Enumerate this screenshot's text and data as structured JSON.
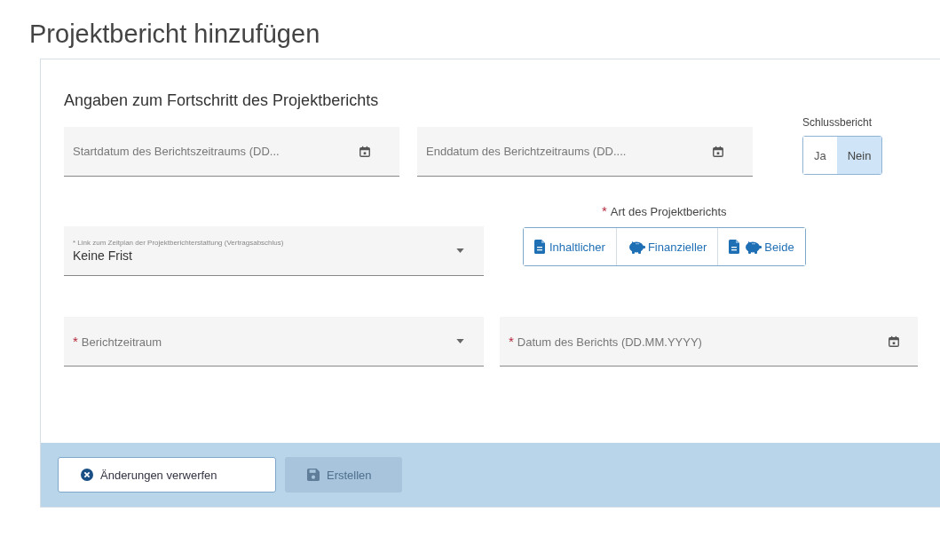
{
  "page_title": "Projektbericht hinzufügen",
  "section_title": "Angaben zum Fortschritt des Projektberichts",
  "start_date": {
    "kind": "date",
    "placeholder": "Startdatum des Berichtszeitraums (DD..."
  },
  "end_date": {
    "kind": "date",
    "placeholder": "Enddatum des Berichtzeitraums (DD...."
  },
  "final_report": {
    "label": "Schlussbericht",
    "options": [
      {
        "label": "Ja",
        "selected": false
      },
      {
        "label": "Nein",
        "selected": true
      }
    ]
  },
  "schedule_link": {
    "kind": "select",
    "label": "* Link zum Zeitplan der Projektberichterstattung (Vertragsabschlus)",
    "value": "Keine Frist"
  },
  "report_type": {
    "required_mark": "*",
    "label": "Art des Projektberichts",
    "options": [
      {
        "kind": "content",
        "label": "Inhaltlicher",
        "selected": false
      },
      {
        "kind": "financial",
        "label": "Finanzieller",
        "selected": false
      },
      {
        "kind": "both",
        "label": "Beide",
        "selected": false
      }
    ]
  },
  "period": {
    "kind": "select",
    "required_mark": "*",
    "placeholder": "Berichtzeitraum"
  },
  "report_date": {
    "kind": "date",
    "required_mark": "*",
    "placeholder": "Datum des Berichts (DD.MM.YYYY)"
  },
  "buttons": [
    {
      "kind": "discard",
      "label": "Änderungen verwerfen",
      "disabled": false
    },
    {
      "kind": "save",
      "label": "Erstellen",
      "disabled": true
    }
  ]
}
